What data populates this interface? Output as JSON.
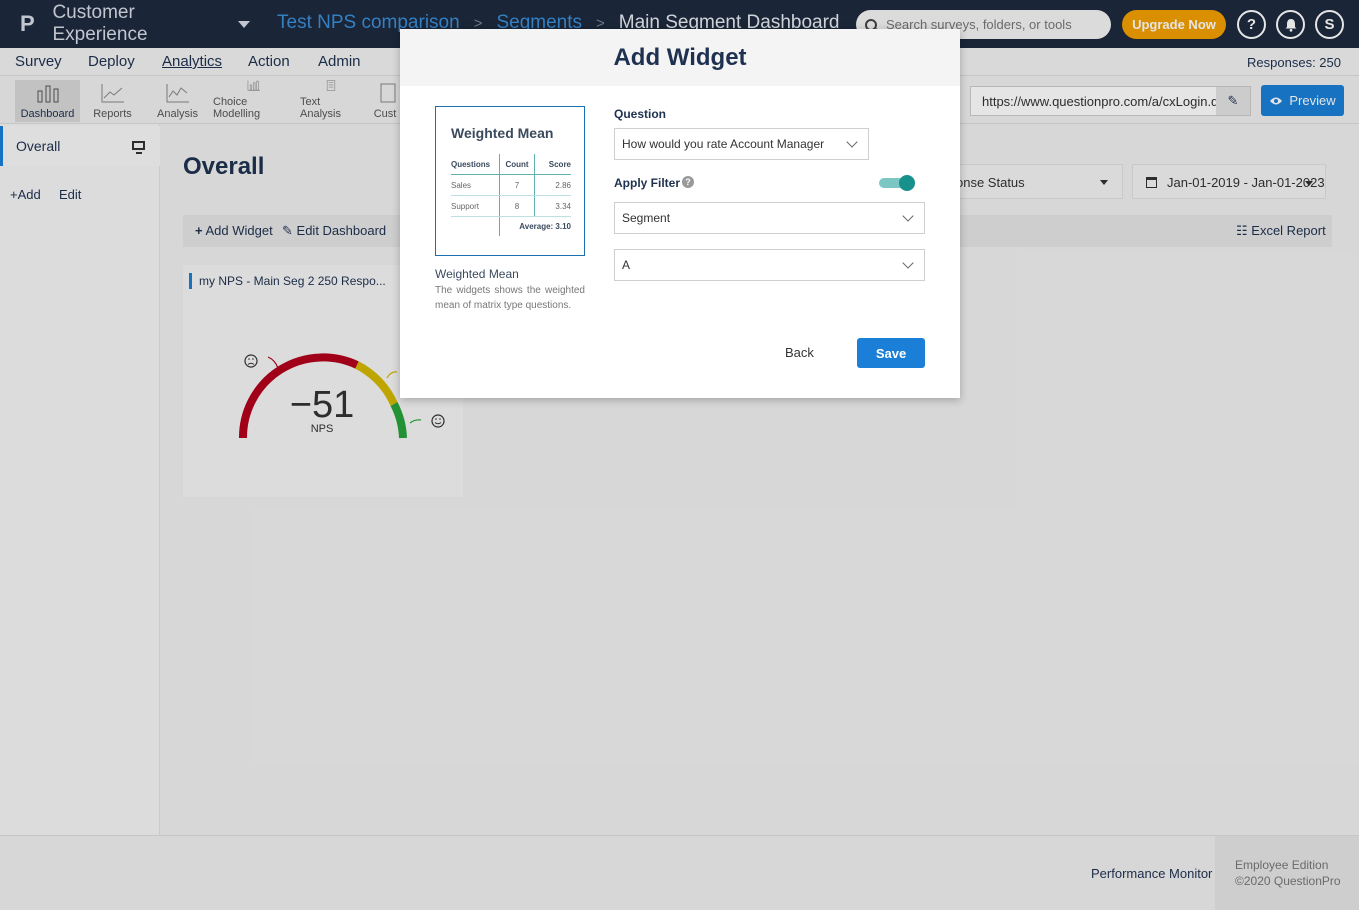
{
  "topbar": {
    "app_name": "Customer Experience",
    "breadcrumbs": [
      "Test NPS comparison",
      "Segments",
      "Main Segment Dashboard"
    ],
    "search_placeholder": "Search surveys, folders, or tools",
    "upgrade_label": "Upgrade Now",
    "help_label": "?",
    "avatar_initial": "S"
  },
  "nav": {
    "items": [
      "Survey",
      "Deploy",
      "Analytics",
      "Action",
      "Admin"
    ],
    "active": "Analytics",
    "responses": "Responses: 250"
  },
  "toolbar": {
    "items": [
      "Dashboard",
      "Reports",
      "Analysis",
      "Choice Modelling",
      "Text Analysis",
      "Cust"
    ],
    "url": "https://www.questionpro.com/a/cxLogin.do",
    "preview_label": "Preview"
  },
  "sidebar": {
    "overall_label": "Overall",
    "add_label": "+Add",
    "edit_label": "Edit"
  },
  "main": {
    "title": "Overall",
    "status_filter": "onse Status",
    "date_range": "Jan-01-2019 - Jan-01-2023",
    "add_widget": "Add Widget",
    "edit_dashboard": "Edit Dashboard",
    "excel_report": "Excel Report",
    "widget_title": "my NPS - Main Seg 2  250 Respo...",
    "nps_value": "−51",
    "nps_label": "NPS"
  },
  "modal": {
    "title": "Add Widget",
    "preview": {
      "title": "Weighted Mean",
      "headers": [
        "Questions",
        "Count",
        "Score"
      ],
      "rows": [
        {
          "q": "Sales",
          "count": "7",
          "score": "2.86"
        },
        {
          "q": "Support",
          "count": "8",
          "score": "3.34"
        }
      ],
      "average": "Average: 3.10"
    },
    "widget_name": "Weighted Mean",
    "widget_desc": "The widgets shows the weighted mean of matrix type questions.",
    "question_label": "Question",
    "question_value": "How would you rate Account Manager",
    "filter_label": "Apply Filter",
    "filter_enabled": true,
    "segment_value": "Segment",
    "segment_option": "A",
    "back_label": "Back",
    "save_label": "Save"
  },
  "footer": {
    "performance_monitor": "Performance Monitor",
    "edition": "Employee Edition",
    "copyright": "©2020 QuestionPro"
  },
  "colors": {
    "header_bg": "#1e2a3e",
    "accent": "#1b7fd8",
    "upgrade": "#f2a000",
    "toggle": "#17918c",
    "gauge_red": "#b3001b",
    "gauge_yellow": "#d4b800",
    "gauge_green": "#27a33a"
  }
}
